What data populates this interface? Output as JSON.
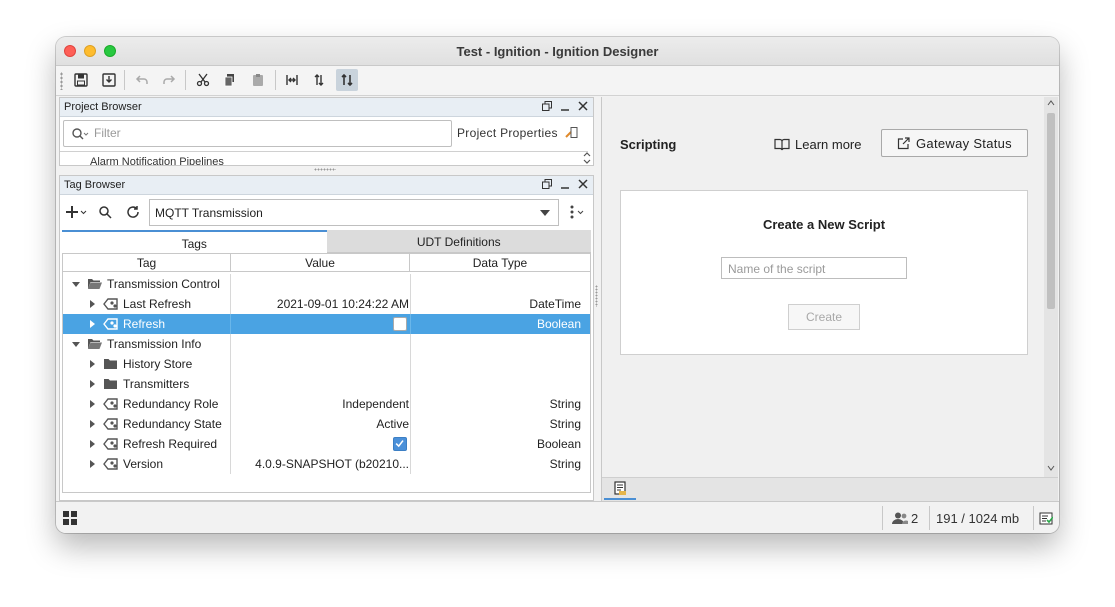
{
  "window": {
    "title": "Test - Ignition - Ignition Designer"
  },
  "project_browser": {
    "title": "Project Browser",
    "filter_placeholder": "Filter",
    "project_properties_label": "Project Properties",
    "partial_item": "Alarm Notification Pipelines"
  },
  "tag_browser": {
    "title": "Tag Browser",
    "provider": "MQTT Transmission",
    "tabs": {
      "tags": "Tags",
      "udt": "UDT Definitions"
    },
    "columns": {
      "tag": "Tag",
      "value": "Value",
      "data_type": "Data Type"
    },
    "rows": [
      {
        "name": "Transmission Control",
        "kind": "folder",
        "level": 0,
        "expanded": true,
        "value": "",
        "type": ""
      },
      {
        "name": "Last Refresh",
        "kind": "tag",
        "level": 1,
        "value": "2021-09-01 10:24:22 AM",
        "type": "DateTime"
      },
      {
        "name": "Refresh",
        "kind": "tag",
        "level": 1,
        "value": "",
        "checkbox": "unchecked",
        "type": "Boolean",
        "selected": true
      },
      {
        "name": "Transmission Info",
        "kind": "folder",
        "level": 0,
        "expanded": true,
        "value": "",
        "type": ""
      },
      {
        "name": "History Store",
        "kind": "folder",
        "level": 1,
        "value": "",
        "type": ""
      },
      {
        "name": "Transmitters",
        "kind": "folder",
        "level": 1,
        "value": "",
        "type": ""
      },
      {
        "name": "Redundancy Role",
        "kind": "tag",
        "level": 1,
        "value": "Independent",
        "type": "String"
      },
      {
        "name": "Redundancy State",
        "kind": "tag",
        "level": 1,
        "value": "Active",
        "type": "String"
      },
      {
        "name": "Refresh Required",
        "kind": "tag",
        "level": 1,
        "value": "",
        "checkbox": "checked",
        "type": "Boolean"
      },
      {
        "name": "Version",
        "kind": "tag",
        "level": 1,
        "value": "4.0.9-SNAPSHOT (b20210...",
        "type": "String"
      }
    ]
  },
  "scripting": {
    "header": "Scripting",
    "learn_more": "Learn more",
    "gateway_status": "Gateway Status",
    "create_title": "Create a New Script",
    "name_placeholder": "Name of the script",
    "create_button": "Create"
  },
  "status": {
    "users": "2",
    "memory": "191 / 1024 mb"
  },
  "colors": {
    "selection": "#4aa3e3",
    "accent": "#4a8fd4",
    "checkbox_checked": "#4a90d9"
  }
}
